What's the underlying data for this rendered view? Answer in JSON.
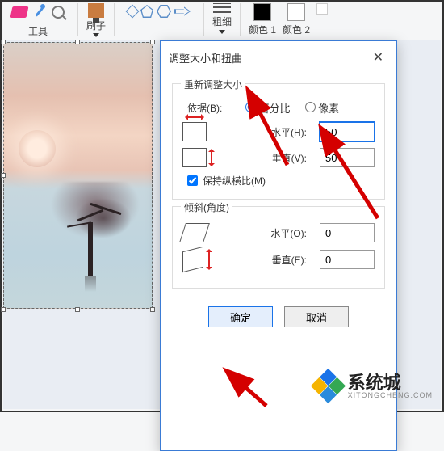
{
  "ribbon": {
    "tools_label": "工具",
    "brush_label": "刷子",
    "thickness_label": "粗细",
    "color1_label": "颜色 1",
    "color2_label": "颜色 2"
  },
  "dialog": {
    "title": "调整大小和扭曲",
    "resize": {
      "group_title": "重新调整大小",
      "by_label": "依据(B):",
      "percent_label": "百分比",
      "pixels_label": "像素",
      "horizontal_label": "水平(H):",
      "vertical_label": "垂直(V):",
      "horizontal_value": "50",
      "vertical_value": "50",
      "keep_ratio_label": "保持纵横比(M)"
    },
    "skew": {
      "group_title": "倾斜(角度)",
      "horizontal_label": "水平(O):",
      "vertical_label": "垂直(E):",
      "horizontal_value": "0",
      "vertical_value": "0"
    },
    "ok_label": "确定",
    "cancel_label": "取消"
  },
  "watermark": {
    "text": "系统城",
    "sub": "XITONGCHENG.COM"
  }
}
